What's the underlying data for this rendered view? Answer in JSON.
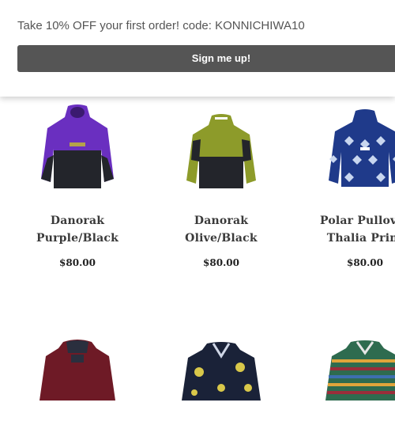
{
  "banner": {
    "promo_text": "Take 10% OFF your first order! code: KONNICHIWA10",
    "button_label": "Sign me up!"
  },
  "products": [
    {
      "line1": "Danorak",
      "line2": "Purple/Black",
      "price": "$80.00",
      "colors": {
        "top": "#6a2fc0",
        "bottom": "#23252b"
      }
    },
    {
      "line1": "Danorak",
      "line2": "Olive/Black",
      "price": "$80.00",
      "colors": {
        "top": "#8d9b2a",
        "bottom": "#23252b"
      }
    },
    {
      "line1": "Polar Pullover",
      "line2": "Thalia Print",
      "price": "$80.00",
      "colors": {
        "top": "#1f3a8a",
        "bottom": "#c8d6ef"
      }
    }
  ],
  "products_row2": [
    {
      "colors": {
        "top": "#6e1a26"
      }
    },
    {
      "colors": {
        "top": "#1a2238"
      }
    },
    {
      "colors": {
        "top": "#2e6b4f"
      }
    }
  ]
}
